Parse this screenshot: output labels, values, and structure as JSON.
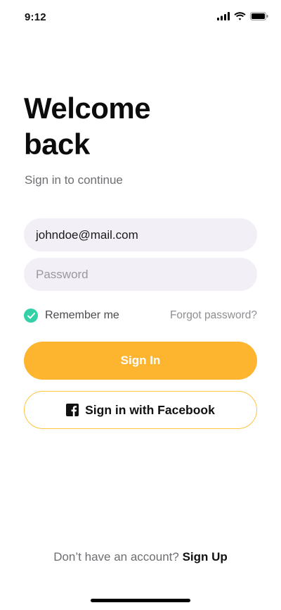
{
  "status_bar": {
    "time": "9:12",
    "icons": [
      "signal-icon",
      "wifi-icon",
      "battery-icon"
    ]
  },
  "header": {
    "title_line1": "Welcome",
    "title_line2": "back",
    "subtitle": "Sign in to continue"
  },
  "form": {
    "email_value": "johndoe@mail.com",
    "password_placeholder": "Password",
    "remember_label": "Remember me",
    "remember_checked": true,
    "forgot_label": "Forgot password?"
  },
  "actions": {
    "sign_in_label": "Sign In",
    "facebook_label": "Sign in with Facebook",
    "facebook_icon": "facebook-icon"
  },
  "footer": {
    "prompt": "Don’t have an account?",
    "signup_label": "Sign Up"
  },
  "colors": {
    "accent": "#fdb52f",
    "check": "#34d0a6",
    "field_bg": "#f2eff6"
  }
}
